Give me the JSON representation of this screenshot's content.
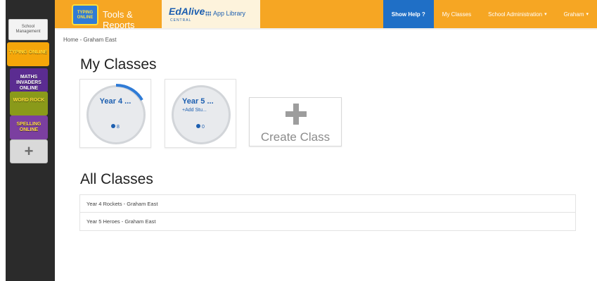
{
  "sidebar": {
    "school_tile": "School Management",
    "apps": [
      {
        "label": "TYPING ONLINE"
      },
      {
        "label": "MATHS INVADERS ONLINE"
      },
      {
        "label": "WORD ROCK"
      },
      {
        "label": "SPELLING ONLINE"
      }
    ],
    "add_label": "+"
  },
  "header": {
    "brand_logo": "TYPING ONLINE",
    "tools_reports": "Tools & Reports",
    "edalive_word": "EdAlive",
    "edalive_sub": "CENTRAL",
    "app_library": "App Library",
    "nav": {
      "help": "Show Help ?",
      "my_classes": "My Classes",
      "school_admin": "School Administration",
      "user": "Graham"
    },
    "colors": {
      "bar": "#f6a623",
      "help": "#1f6fc6",
      "link": "#1d5fb0"
    }
  },
  "breadcrumb": "Home - Graham East",
  "my_classes": {
    "title": "My Classes",
    "cards": [
      {
        "name": "Year 4 ...",
        "count": "8",
        "progress": 0.18
      },
      {
        "name": "Year 5 ...",
        "sub": "+Add Stu...",
        "count": "0",
        "progress": 0
      }
    ],
    "create_label": "Create Class"
  },
  "all_classes": {
    "title": "All Classes",
    "rows": [
      "Year 4 Rockets - Graham East",
      "Year 5 Heroes - Graham East"
    ]
  }
}
